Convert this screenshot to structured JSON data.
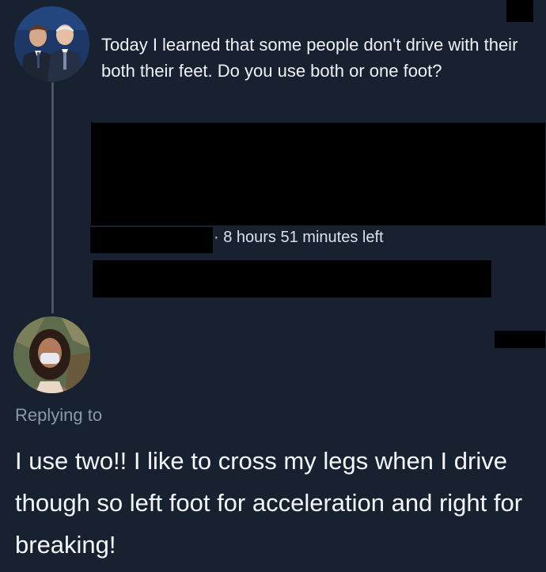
{
  "original_tweet": {
    "avatar_icon": "profile-photo-avatar",
    "text": "Today I learned that some people don't drive with their both their feet. Do you use both or one foot?",
    "poll": {
      "time_left": "· 8 hours 51 minutes left"
    }
  },
  "reply_tweet": {
    "avatar_icon": "profile-photo-avatar",
    "replying_to_label": "Replying to",
    "text": "I use two!! I like to cross my legs when I drive though so left foot for acceleration and right for breaking!"
  },
  "colors": {
    "background": "#172130",
    "text_primary": "#eef2f6",
    "text_secondary": "#8b98a5",
    "redaction": "#000000",
    "thread_line": "#4a5563"
  }
}
